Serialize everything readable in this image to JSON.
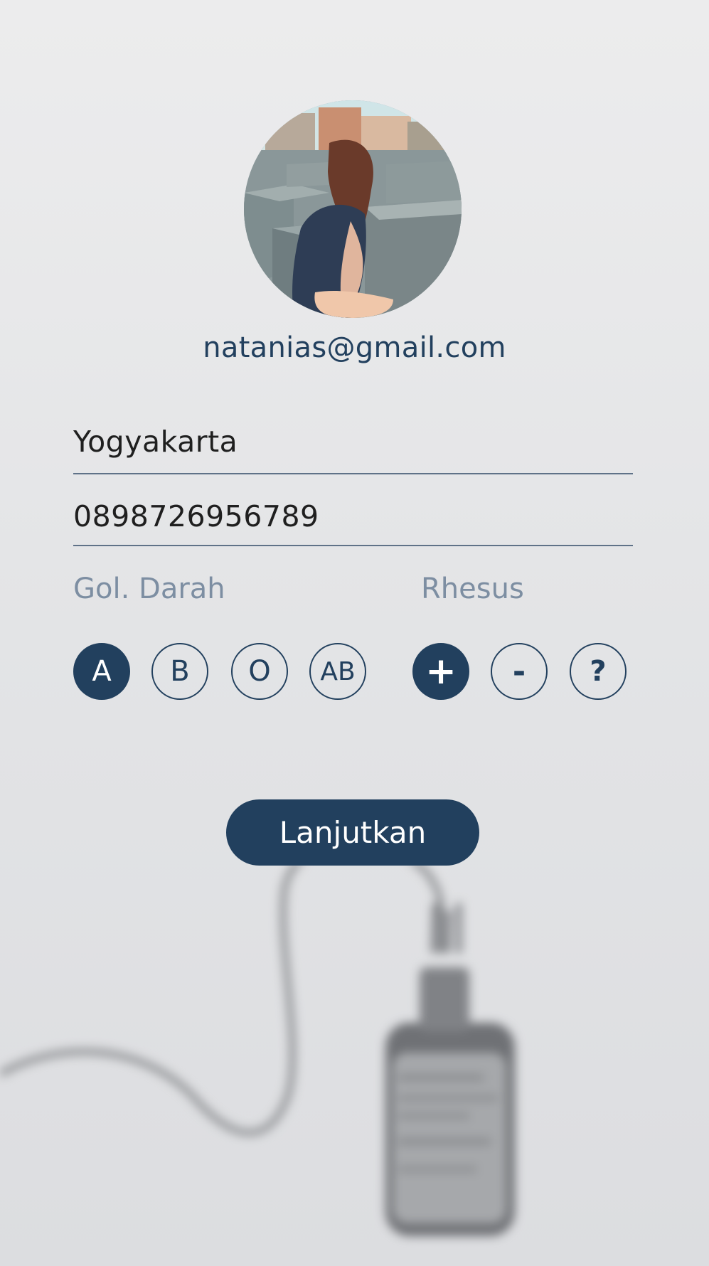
{
  "profile": {
    "email": "natanias@gmail.com",
    "avatar_icon": "profile-photo"
  },
  "form": {
    "city_value": "Yogyakarta",
    "phone_value": "0898726956789"
  },
  "blood_type": {
    "label": "Gol. Darah",
    "options": [
      "A",
      "B",
      "O",
      "AB"
    ],
    "selected": "A"
  },
  "rhesus": {
    "label": "Rhesus",
    "options": [
      "+",
      "-",
      "?"
    ],
    "selected": "+"
  },
  "actions": {
    "continue_label": "Lanjutkan"
  },
  "colors": {
    "primary": "#22405e",
    "label": "#7d8ea2",
    "underline": "#5f7288",
    "background": "#e4e5e7"
  }
}
